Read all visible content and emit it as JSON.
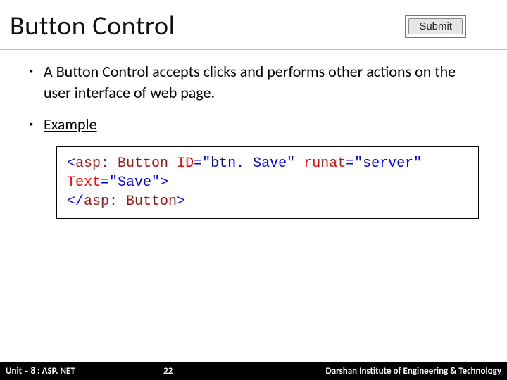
{
  "header": {
    "title": "Button Control",
    "submit_label": "Submit"
  },
  "bullets": {
    "b1": "A Button Control accepts clicks and performs other actions on the user interface of web page.",
    "b2_label": "Example"
  },
  "code": {
    "open_angle": "<",
    "tag": "asp: Button",
    "sp": " ",
    "attr_id": "ID",
    "eq": "=",
    "val_id": "\"btn. Save\"",
    "attr_runat": "runat",
    "val_runat": "\"server\"",
    "attr_text": "Text",
    "val_text": "\"Save\"",
    "close_angle": ">",
    "open_end": "</",
    "end_tag": "asp: Button",
    "end_close": ">"
  },
  "footer": {
    "unit": "Unit – 8 : ASP. NET",
    "page": "22",
    "institute": "Darshan Institute of Engineering & Technology"
  }
}
